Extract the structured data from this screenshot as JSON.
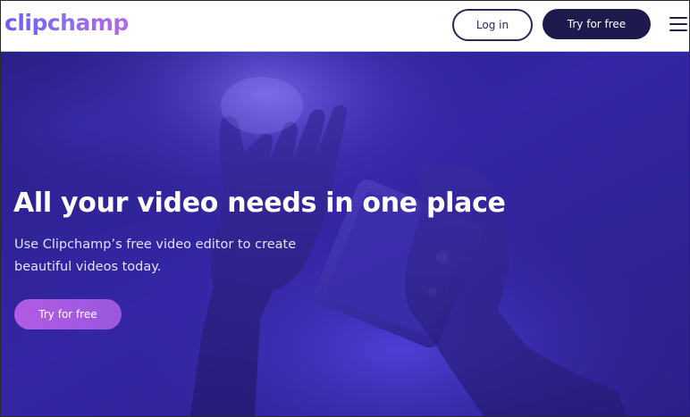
{
  "header": {
    "logo_text": "clipchamp",
    "login_label": "Log in",
    "try_label": "Try for free",
    "menu_icon": "hamburger-menu-icon"
  },
  "hero": {
    "title": "All your video needs in one place",
    "subtitle": "Use Clipchamp’s free video editor to create beautiful videos today.",
    "cta_label": "Try for free"
  },
  "colors": {
    "brand_dark": "#1f1a4e",
    "hero_bg": "#2c2090",
    "cta_purple": "#a95ae2",
    "logo_gradient_start": "#6a5cff",
    "logo_gradient_end": "#b06ae6"
  }
}
